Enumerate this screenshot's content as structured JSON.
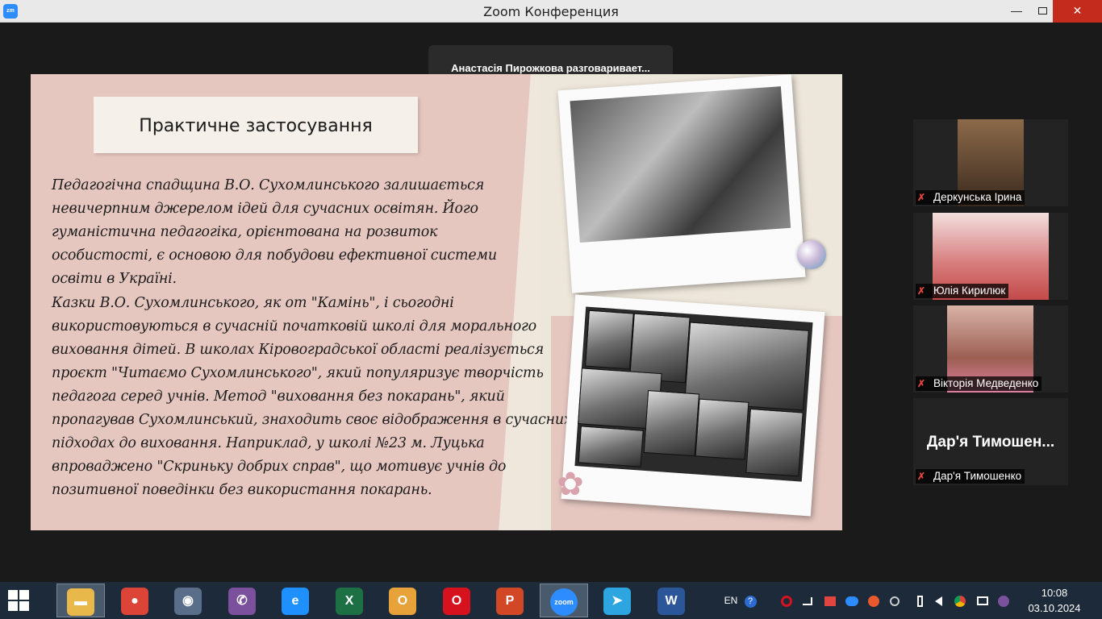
{
  "window": {
    "app_icon_label": "zm",
    "title": "Zoom Конференция",
    "min_glyph": "—",
    "close_glyph": "✕"
  },
  "meeting": {
    "active_speaker": "Анастасія Пирожкова разговаривает..."
  },
  "slide": {
    "heading": "Практичне застосування",
    "paragraph_1": "Педагогічна спадщина В.О. Сухомлинського залишається невичерпним джерелом ідей для сучасних освітян. Його гуманістична педагогіка, орієнтована на розвиток особистості, є основою для побудови ефективної системи освіти в Україні.",
    "paragraph_2": "Казки В.О. Сухомлинського, як от \"Камінь\", і сьогодні використовуються в сучасній початковій школі для морального виховання дітей. В школах Кіровоградської області реалізується проєкт \"Читаємо Сухомлинського\", який популяризує творчість педагога серед учнів. Метод \"виховання без покарань\", який пропагував Сухомлинський, знаходить своє відображення в сучасних підходах до виховання. Наприклад, у школі №23 м. Луцька впроваджено \"Скриньку добрих справ\", що мотивує учнів до позитивної поведінки без використання покарань.",
    "flower_glyph": "✿"
  },
  "participants": [
    {
      "name": "Деркунська Ірина",
      "video_color": "#6b4a2e"
    },
    {
      "name": "Юлія Кирилюк",
      "video_color": "#d98a8a"
    },
    {
      "name": "Вікторія Медведенко",
      "video_color": "#b07868"
    },
    {
      "name": "Дар'я Тимошенко",
      "display_text": "Дар'я Тимошен..."
    }
  ],
  "mic_glyph": "✗",
  "taskbar": {
    "apps": [
      {
        "name": "file-explorer",
        "glyph": "▬",
        "color": "#e8b84a"
      },
      {
        "name": "chrome",
        "glyph": "●",
        "color": "#db4437"
      },
      {
        "name": "zoom-camera-app",
        "glyph": "◉",
        "color": "#5a6e8a"
      },
      {
        "name": "viber",
        "glyph": "✆",
        "color": "#7b519d"
      },
      {
        "name": "internet-explorer",
        "glyph": "e",
        "color": "#1e90ff"
      },
      {
        "name": "excel",
        "glyph": "X",
        "color": "#1d7044"
      },
      {
        "name": "outlook",
        "glyph": "O",
        "color": "#e8a23a"
      },
      {
        "name": "opera",
        "glyph": "O",
        "color": "#d7121f"
      },
      {
        "name": "powerpoint",
        "glyph": "P",
        "color": "#d24726"
      },
      {
        "name": "zoom",
        "glyph": "zoom",
        "color": "#2d8cff"
      },
      {
        "name": "telegram",
        "glyph": "➤",
        "color": "#2ca5e0"
      },
      {
        "name": "word",
        "glyph": "W",
        "color": "#2b579a"
      }
    ],
    "language": "EN",
    "help_glyph": "?",
    "time": "10:08",
    "date": "03.10.2024"
  }
}
